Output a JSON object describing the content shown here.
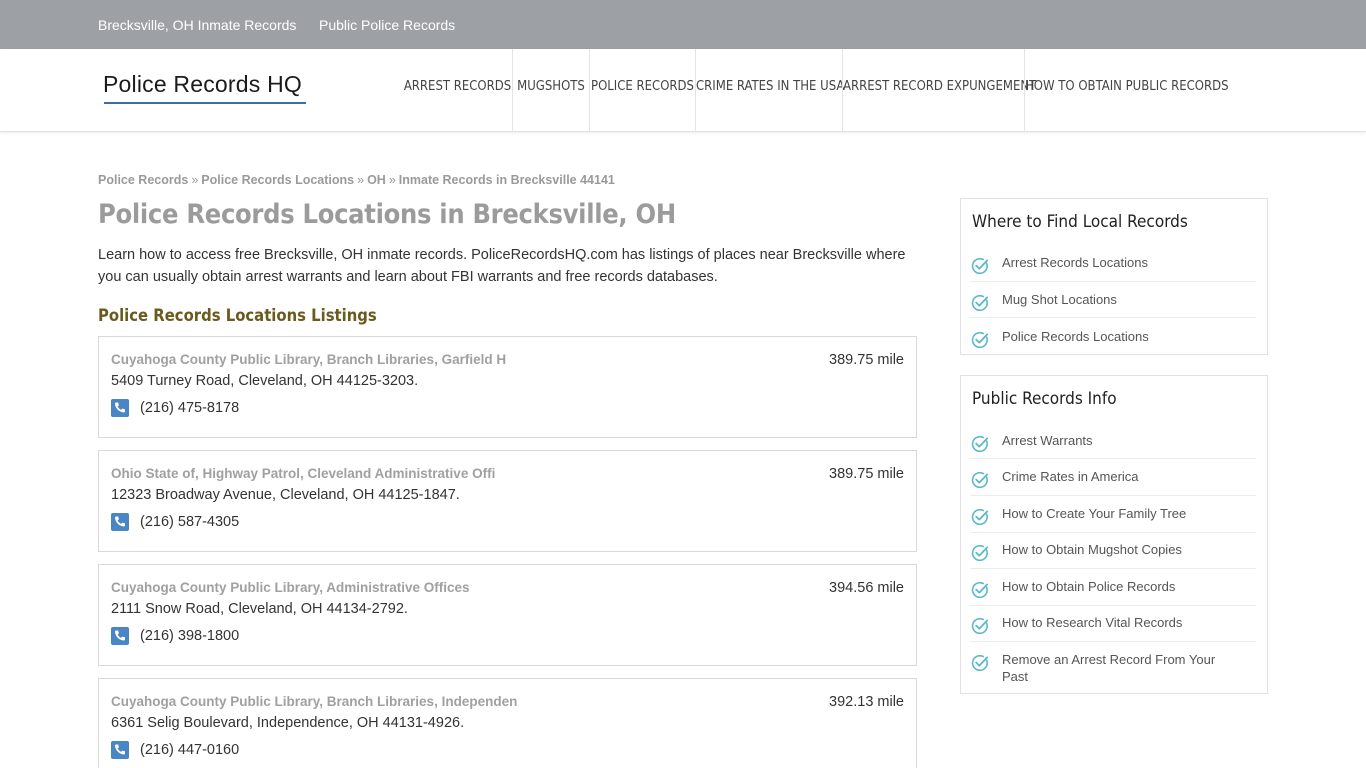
{
  "topbar": {
    "links": [
      "Brecksville, OH Inmate Records",
      "Public Police Records"
    ]
  },
  "header": {
    "logo": "Police Records HQ",
    "nav": [
      "ARREST RECORDS",
      "MUGSHOTS",
      "POLICE RECORDS",
      "CRIME RATES IN THE USA",
      "ARREST RECORD EXPUNGEMENT",
      "HOW TO OBTAIN PUBLIC RECORDS"
    ]
  },
  "breadcrumb": {
    "items": [
      "Police Records",
      "Police Records Locations",
      "OH"
    ],
    "separator": "»",
    "current": "Inmate Records in Brecksville 44141"
  },
  "main": {
    "title": "Police Records Locations in Brecksville, OH",
    "intro": "Learn how to access free Brecksville, OH inmate records. PoliceRecordsHQ.com has listings of places near Brecksville where you can usually obtain arrest warrants and learn about FBI warrants and free records databases.",
    "listings_title": "Police Records Locations Listings",
    "listings": [
      {
        "name": "Cuyahoga County Public Library, Branch Libraries, Garfield H",
        "distance": "389.75 mile",
        "address": "5409 Turney Road, Cleveland, OH 44125-3203.",
        "phone": "(216) 475-8178"
      },
      {
        "name": "Ohio State of, Highway Patrol, Cleveland Administrative Offi",
        "distance": "389.75 mile",
        "address": "12323 Broadway Avenue, Cleveland, OH 44125-1847.",
        "phone": "(216) 587-4305"
      },
      {
        "name": "Cuyahoga County Public Library, Administrative Offices",
        "distance": "394.56 mile",
        "address": "2111 Snow Road, Cleveland, OH 44134-2792.",
        "phone": "(216) 398-1800"
      },
      {
        "name": "Cuyahoga County Public Library, Branch Libraries, Independen",
        "distance": "392.13 mile",
        "address": "6361 Selig Boulevard, Independence, OH 44131-4926.",
        "phone": "(216) 447-0160"
      }
    ]
  },
  "sidebar": {
    "widgets": [
      {
        "title": "Where to Find Local Records",
        "items": [
          "Arrest Records Locations",
          "Mug Shot Locations",
          "Police Records Locations"
        ]
      },
      {
        "title": "Public Records Info",
        "items": [
          "Arrest Warrants",
          "Crime Rates in America",
          "How to Create Your Family Tree",
          "How to Obtain Mugshot Copies",
          "How to Obtain Police Records",
          "How to Research Vital Records",
          "Remove an Arrest Record From Your Past"
        ]
      }
    ]
  },
  "colors": {
    "topbar": "#9da1a5",
    "logo_underline": "#3b6ea5",
    "phone_icon": "#4a86c6",
    "check_icon": "#5bb8c9",
    "section_title": "#6b5a1e"
  },
  "icons": {
    "phone": "phone-icon",
    "check": "check-circle-icon"
  }
}
